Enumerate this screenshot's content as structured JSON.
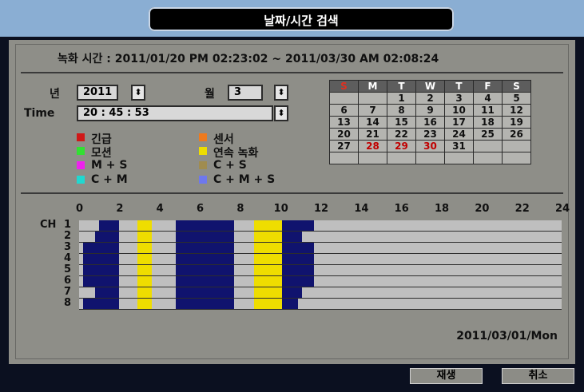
{
  "header": {
    "title": "날짜/시간 검색"
  },
  "record_range": "녹화 시간 : 2011/01/20 PM 02:23:02 ~ 2011/03/30 AM 02:08:24",
  "year": {
    "label": "년",
    "value": "2011"
  },
  "month": {
    "label": "월",
    "value": "3"
  },
  "time": {
    "label": "Time",
    "value": "20 : 45 : 53"
  },
  "spin_glyph": "⬍",
  "legend": [
    {
      "label": "긴급",
      "color": "#d01818"
    },
    {
      "label": "센서",
      "color": "#ee7a1e"
    },
    {
      "label": "모션",
      "color": "#32e032"
    },
    {
      "label": "연속 녹화",
      "color": "#eedd00"
    },
    {
      "label": "M + S",
      "color": "#ee22ee"
    },
    {
      "label": "C + S",
      "color": "#a08c50"
    },
    {
      "label": "C + M",
      "color": "#20d8d0"
    },
    {
      "label": "C + M + S",
      "color": "#6e78ee"
    }
  ],
  "calendar": {
    "weekdays": [
      "S",
      "M",
      "T",
      "W",
      "T",
      "F",
      "S"
    ],
    "weeks": [
      [
        "",
        "",
        "1",
        "2",
        "3",
        "4",
        "5"
      ],
      [
        "6",
        "7",
        "8",
        "9",
        "10",
        "11",
        "12"
      ],
      [
        "13",
        "14",
        "15",
        "16",
        "17",
        "18",
        "19"
      ],
      [
        "20",
        "21",
        "22",
        "23",
        "24",
        "25",
        "26"
      ],
      [
        "27",
        "28",
        "29",
        "30",
        "31",
        "",
        ""
      ],
      [
        "",
        "",
        "",
        "",
        "",
        "",
        ""
      ]
    ],
    "highlighted_days": [
      "28",
      "29",
      "30"
    ]
  },
  "timeline": {
    "hour_ticks": [
      "0",
      "2",
      "4",
      "6",
      "8",
      "10",
      "12",
      "14",
      "16",
      "18",
      "20",
      "22",
      "24"
    ],
    "channel_prefix": "CH",
    "channels": [
      "1",
      "2",
      "3",
      "4",
      "5",
      "6",
      "7",
      "8"
    ],
    "colors": {
      "recording": "#10136e",
      "continuous": "#eedd00",
      "empty": "#bfbfbf"
    },
    "recordings": [
      [
        [
          1.0,
          2.0,
          "recording"
        ],
        [
          2.9,
          3.6,
          "continuous"
        ],
        [
          4.8,
          7.7,
          "recording"
        ],
        [
          8.7,
          10.1,
          "continuous"
        ],
        [
          10.1,
          11.7,
          "recording"
        ]
      ],
      [
        [
          0.8,
          2.0,
          "recording"
        ],
        [
          2.9,
          3.6,
          "continuous"
        ],
        [
          4.8,
          7.7,
          "recording"
        ],
        [
          8.7,
          10.1,
          "continuous"
        ],
        [
          10.1,
          11.1,
          "recording"
        ]
      ],
      [
        [
          0.2,
          2.0,
          "recording"
        ],
        [
          2.9,
          3.6,
          "continuous"
        ],
        [
          4.8,
          7.7,
          "recording"
        ],
        [
          8.7,
          10.1,
          "continuous"
        ],
        [
          10.1,
          11.7,
          "recording"
        ]
      ],
      [
        [
          0.2,
          2.0,
          "recording"
        ],
        [
          2.9,
          3.6,
          "continuous"
        ],
        [
          4.8,
          7.7,
          "recording"
        ],
        [
          8.7,
          10.1,
          "continuous"
        ],
        [
          10.1,
          11.7,
          "recording"
        ]
      ],
      [
        [
          0.2,
          2.0,
          "recording"
        ],
        [
          2.9,
          3.6,
          "continuous"
        ],
        [
          4.8,
          7.7,
          "recording"
        ],
        [
          8.7,
          10.1,
          "continuous"
        ],
        [
          10.1,
          11.7,
          "recording"
        ]
      ],
      [
        [
          0.2,
          2.0,
          "recording"
        ],
        [
          2.9,
          3.6,
          "continuous"
        ],
        [
          4.8,
          7.7,
          "recording"
        ],
        [
          8.7,
          10.1,
          "continuous"
        ],
        [
          10.1,
          11.7,
          "recording"
        ]
      ],
      [
        [
          0.8,
          2.0,
          "recording"
        ],
        [
          2.9,
          3.6,
          "continuous"
        ],
        [
          4.8,
          7.7,
          "recording"
        ],
        [
          8.7,
          10.1,
          "continuous"
        ],
        [
          10.1,
          11.1,
          "recording"
        ]
      ],
      [
        [
          0.2,
          2.0,
          "recording"
        ],
        [
          2.9,
          3.6,
          "continuous"
        ],
        [
          4.8,
          7.7,
          "recording"
        ],
        [
          8.7,
          10.1,
          "continuous"
        ],
        [
          10.1,
          10.9,
          "recording"
        ]
      ]
    ]
  },
  "date_stamp": "2011/03/01/Mon",
  "buttons": {
    "play": "재생",
    "cancel": "취소"
  }
}
